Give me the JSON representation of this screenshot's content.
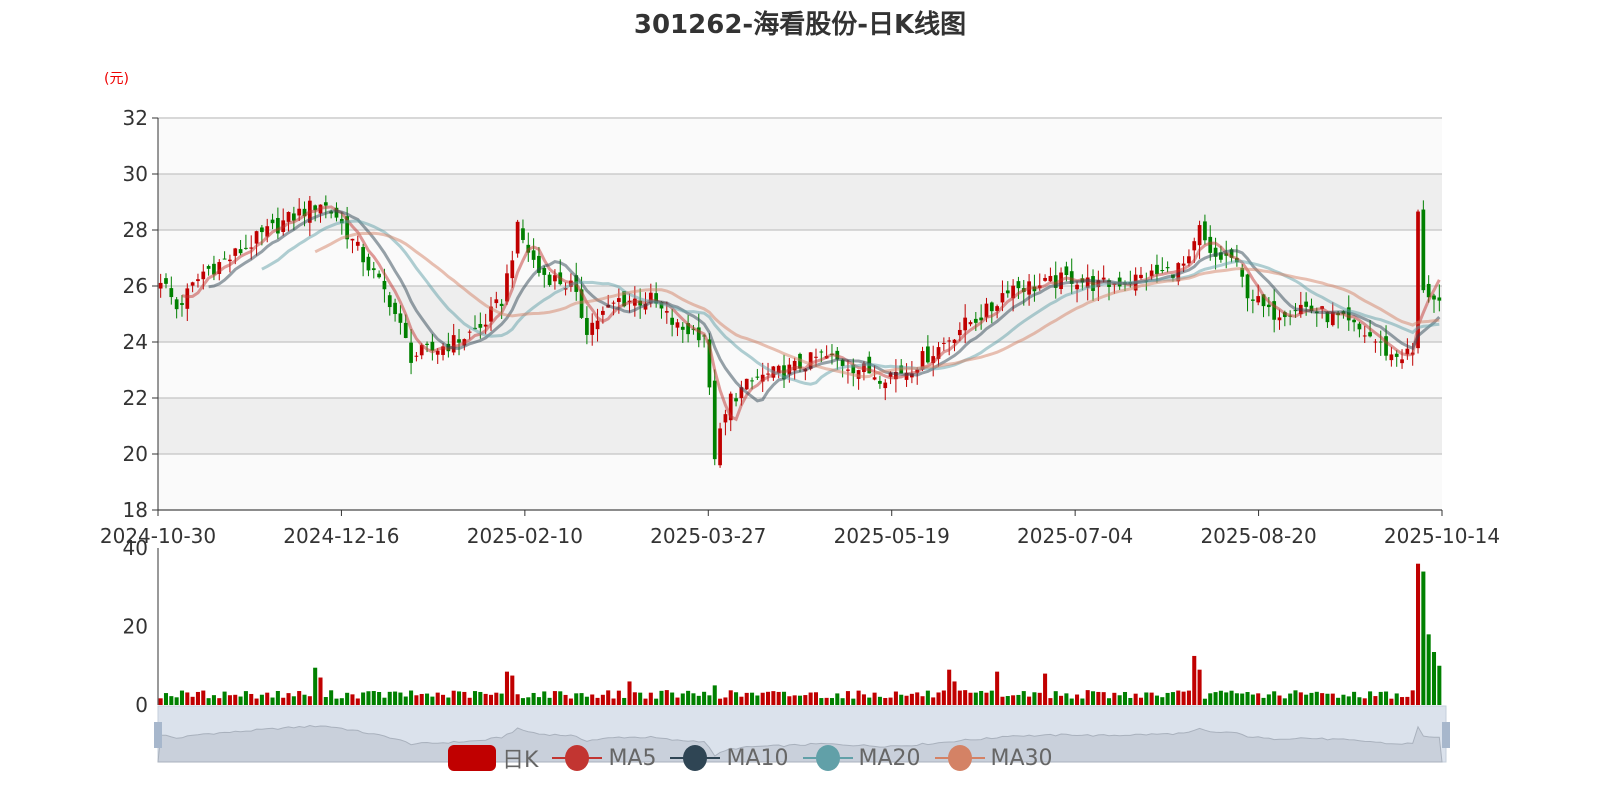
{
  "title": "301262-海看股份-日K线图",
  "unit": "(元)",
  "legend": [
    {
      "label": "日K",
      "color": "#c00000"
    },
    {
      "label": "MA5",
      "color": "#c23531"
    },
    {
      "label": "MA10",
      "color": "#2f4554"
    },
    {
      "label": "MA20",
      "color": "#61a0a8"
    },
    {
      "label": "MA30",
      "color": "#d48265"
    }
  ],
  "colors": {
    "up": "#c00000",
    "down": "#008000",
    "grid_band": "#eeeeee"
  },
  "chart_data": {
    "type": "candlestick",
    "title": "301262-海看股份-日K线图",
    "ylabel": "(元)",
    "ylim": [
      18,
      32
    ],
    "yticks": [
      18,
      20,
      22,
      24,
      26,
      28,
      30,
      32
    ],
    "volume_ylim": [
      0,
      40
    ],
    "volume_yticks": [
      0,
      20,
      40
    ],
    "xtick_labels": [
      "2024-10-30",
      "2024-12-16",
      "2025-02-10",
      "2025-03-27",
      "2025-05-19",
      "2025-07-04",
      "2025-08-20",
      "2025-10-14"
    ],
    "num_days": 241,
    "close_keypoints": [
      [
        0,
        26.3
      ],
      [
        3,
        25.2
      ],
      [
        8,
        26.5
      ],
      [
        13,
        27
      ],
      [
        19,
        27.8
      ],
      [
        25,
        28.5
      ],
      [
        30,
        29
      ],
      [
        33,
        28.5
      ],
      [
        38,
        27
      ],
      [
        43,
        25.5
      ],
      [
        47,
        23.5
      ],
      [
        51,
        23.7
      ],
      [
        55,
        24
      ],
      [
        60,
        24.5
      ],
      [
        64,
        25.5
      ],
      [
        67,
        28
      ],
      [
        71,
        26.5
      ],
      [
        77,
        26
      ],
      [
        80,
        24.5
      ],
      [
        86,
        25.5
      ],
      [
        92,
        25.5
      ],
      [
        97,
        24.5
      ],
      [
        102,
        24.3
      ],
      [
        104,
        20
      ],
      [
        107,
        22
      ],
      [
        112,
        22.7
      ],
      [
        118,
        23
      ],
      [
        124,
        23.5
      ],
      [
        129,
        23.2
      ],
      [
        135,
        22.8
      ],
      [
        140,
        23
      ],
      [
        146,
        23.8
      ],
      [
        150,
        24.5
      ],
      [
        156,
        25.2
      ],
      [
        159,
        26
      ],
      [
        165,
        26
      ],
      [
        171,
        26.3
      ],
      [
        176,
        26
      ],
      [
        184,
        26.3
      ],
      [
        189,
        26.5
      ],
      [
        193,
        26.8
      ],
      [
        195,
        28
      ],
      [
        197,
        27
      ],
      [
        201,
        27
      ],
      [
        204,
        25.8
      ],
      [
        208,
        25
      ],
      [
        214,
        25.3
      ],
      [
        221,
        24.8
      ],
      [
        227,
        24.2
      ],
      [
        231,
        23.5
      ],
      [
        235,
        23.6
      ],
      [
        236,
        28.5
      ],
      [
        237,
        26
      ],
      [
        240,
        25.2
      ]
    ],
    "volume_spikes": [
      [
        29,
        9.5
      ],
      [
        30,
        7
      ],
      [
        65,
        8.5
      ],
      [
        66,
        7.5
      ],
      [
        88,
        6
      ],
      [
        104,
        5
      ],
      [
        148,
        9
      ],
      [
        149,
        6
      ],
      [
        157,
        8.5
      ],
      [
        166,
        8
      ],
      [
        194,
        12.5
      ],
      [
        195,
        9
      ],
      [
        236,
        36
      ],
      [
        237,
        34
      ],
      [
        238,
        18
      ],
      [
        239,
        13.5
      ],
      [
        240,
        10
      ]
    ],
    "ma_periods": [
      5,
      10,
      20,
      30
    ]
  }
}
